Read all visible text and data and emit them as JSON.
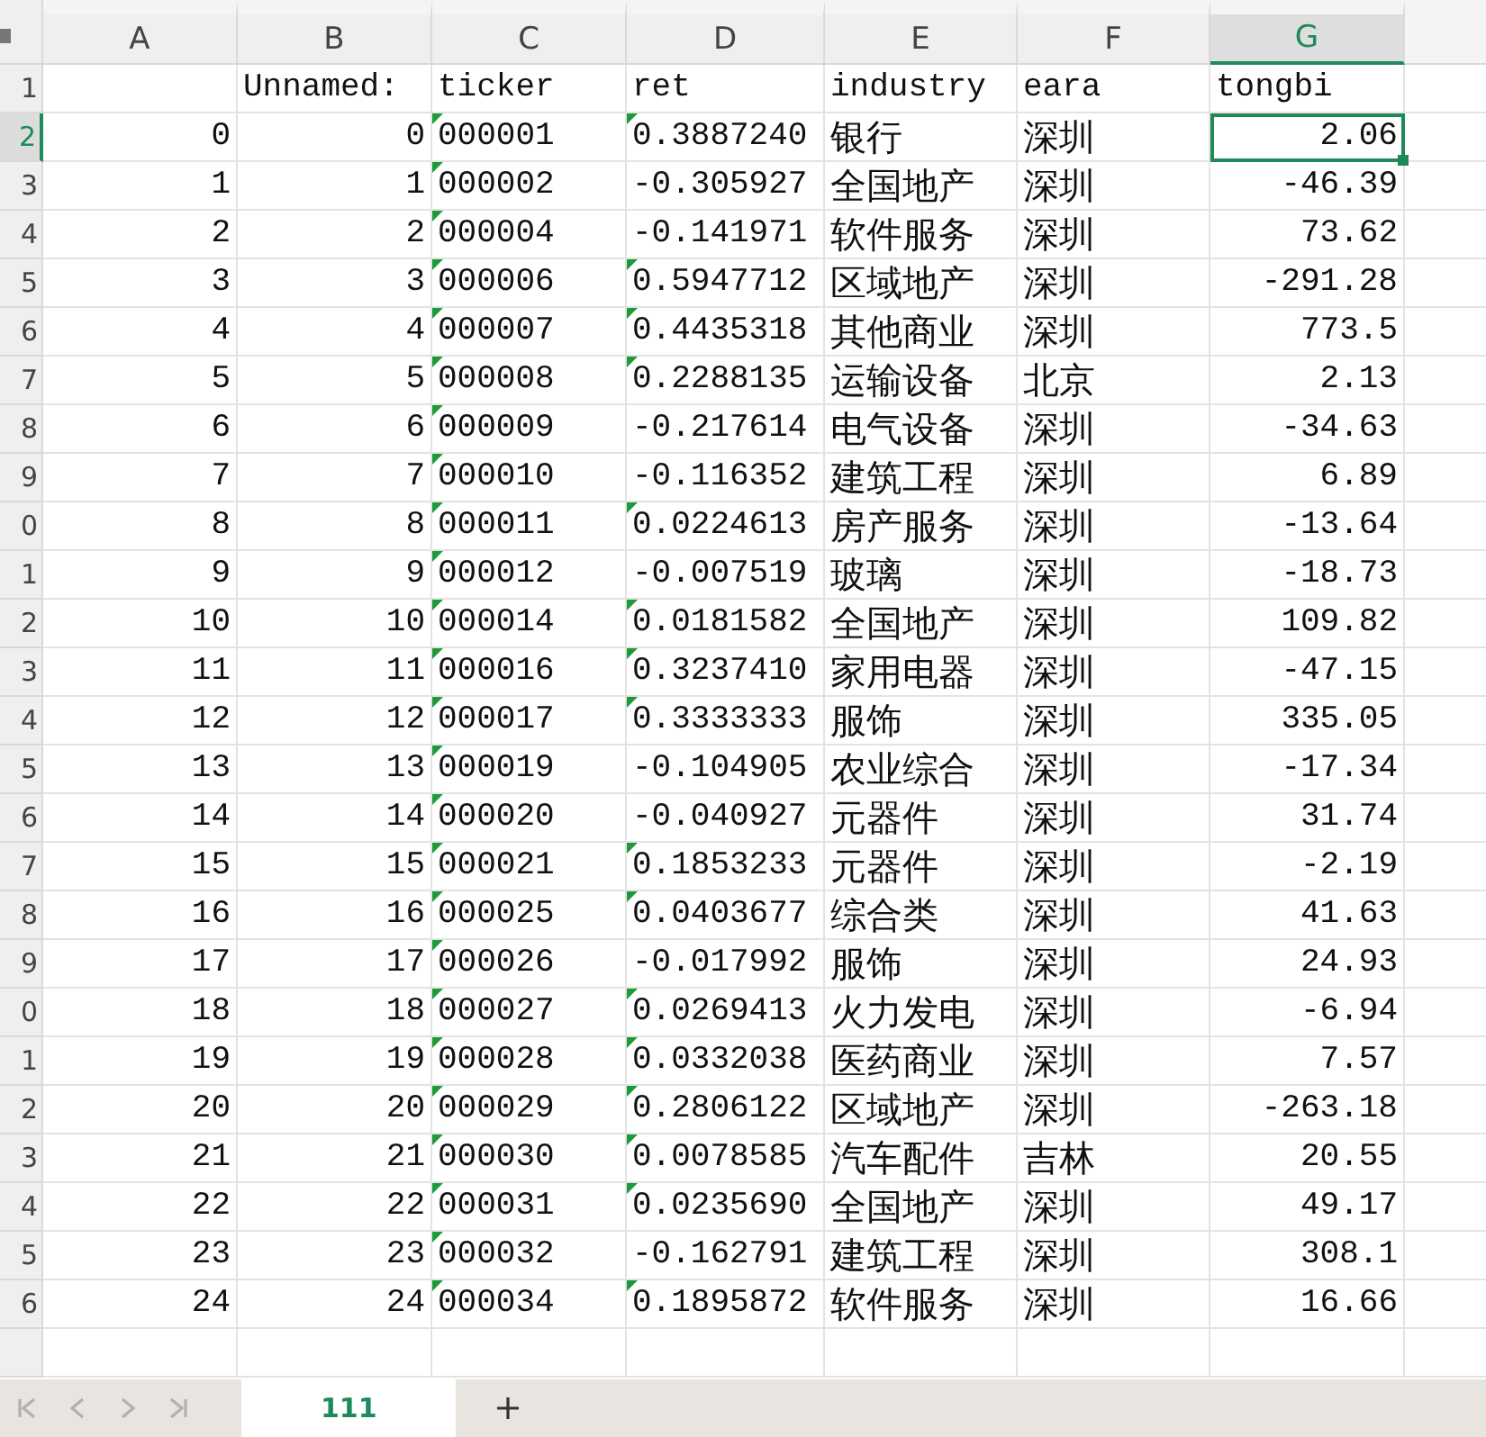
{
  "columns": [
    {
      "label": "A",
      "selected": false
    },
    {
      "label": "B",
      "selected": false
    },
    {
      "label": "C",
      "selected": false
    },
    {
      "label": "D",
      "selected": false
    },
    {
      "label": "E",
      "selected": false
    },
    {
      "label": "F",
      "selected": false
    },
    {
      "label": "G",
      "selected": true
    }
  ],
  "rows": [
    {
      "header": "1",
      "selected": false,
      "cells": [
        {
          "kind": "empty"
        },
        {
          "text": "Unnamed:",
          "kind": "text"
        },
        {
          "text": "ticker",
          "kind": "text"
        },
        {
          "text": "ret",
          "kind": "text"
        },
        {
          "text": "industry",
          "kind": "text"
        },
        {
          "text": "eara",
          "kind": "text"
        },
        {
          "text": "tongbi",
          "kind": "text"
        }
      ]
    },
    {
      "header": "2",
      "selected": true,
      "cells": [
        {
          "text": "0",
          "kind": "number"
        },
        {
          "text": "0",
          "kind": "number"
        },
        {
          "text": "000001",
          "kind": "flagged"
        },
        {
          "text": "0.3887240",
          "kind": "flagged"
        },
        {
          "text": "银行",
          "kind": "text"
        },
        {
          "text": "深圳",
          "kind": "text"
        },
        {
          "text": "2.06",
          "kind": "number"
        }
      ]
    },
    {
      "header": "3",
      "selected": false,
      "cells": [
        {
          "text": "1",
          "kind": "number"
        },
        {
          "text": "1",
          "kind": "number"
        },
        {
          "text": "000002",
          "kind": "flagged"
        },
        {
          "text": "-0.305927",
          "kind": "text"
        },
        {
          "text": "全国地产",
          "kind": "text"
        },
        {
          "text": "深圳",
          "kind": "text"
        },
        {
          "text": "-46.39",
          "kind": "number"
        }
      ]
    },
    {
      "header": "4",
      "selected": false,
      "cells": [
        {
          "text": "2",
          "kind": "number"
        },
        {
          "text": "2",
          "kind": "number"
        },
        {
          "text": "000004",
          "kind": "flagged"
        },
        {
          "text": "-0.141971",
          "kind": "text"
        },
        {
          "text": "软件服务",
          "kind": "text"
        },
        {
          "text": "深圳",
          "kind": "text"
        },
        {
          "text": "73.62",
          "kind": "number"
        }
      ]
    },
    {
      "header": "5",
      "selected": false,
      "cells": [
        {
          "text": "3",
          "kind": "number"
        },
        {
          "text": "3",
          "kind": "number"
        },
        {
          "text": "000006",
          "kind": "flagged"
        },
        {
          "text": "0.5947712",
          "kind": "flagged"
        },
        {
          "text": "区域地产",
          "kind": "text"
        },
        {
          "text": "深圳",
          "kind": "text"
        },
        {
          "text": "-291.28",
          "kind": "number"
        }
      ]
    },
    {
      "header": "6",
      "selected": false,
      "cells": [
        {
          "text": "4",
          "kind": "number"
        },
        {
          "text": "4",
          "kind": "number"
        },
        {
          "text": "000007",
          "kind": "flagged"
        },
        {
          "text": "0.4435318",
          "kind": "flagged"
        },
        {
          "text": "其他商业",
          "kind": "text"
        },
        {
          "text": "深圳",
          "kind": "text"
        },
        {
          "text": "773.5",
          "kind": "number"
        }
      ]
    },
    {
      "header": "7",
      "selected": false,
      "cells": [
        {
          "text": "5",
          "kind": "number"
        },
        {
          "text": "5",
          "kind": "number"
        },
        {
          "text": "000008",
          "kind": "flagged"
        },
        {
          "text": "0.2288135",
          "kind": "flagged"
        },
        {
          "text": "运输设备",
          "kind": "text"
        },
        {
          "text": "北京",
          "kind": "text"
        },
        {
          "text": "2.13",
          "kind": "number"
        }
      ]
    },
    {
      "header": "8",
      "selected": false,
      "cells": [
        {
          "text": "6",
          "kind": "number"
        },
        {
          "text": "6",
          "kind": "number"
        },
        {
          "text": "000009",
          "kind": "flagged"
        },
        {
          "text": "-0.217614",
          "kind": "text"
        },
        {
          "text": "电气设备",
          "kind": "text"
        },
        {
          "text": "深圳",
          "kind": "text"
        },
        {
          "text": "-34.63",
          "kind": "number"
        }
      ]
    },
    {
      "header": "9",
      "selected": false,
      "cells": [
        {
          "text": "7",
          "kind": "number"
        },
        {
          "text": "7",
          "kind": "number"
        },
        {
          "text": "000010",
          "kind": "flagged"
        },
        {
          "text": "-0.116352",
          "kind": "text"
        },
        {
          "text": "建筑工程",
          "kind": "text"
        },
        {
          "text": "深圳",
          "kind": "text"
        },
        {
          "text": "6.89",
          "kind": "number"
        }
      ]
    },
    {
      "header": "0",
      "selected": false,
      "cells": [
        {
          "text": "8",
          "kind": "number"
        },
        {
          "text": "8",
          "kind": "number"
        },
        {
          "text": "000011",
          "kind": "flagged"
        },
        {
          "text": "0.0224613",
          "kind": "flagged"
        },
        {
          "text": "房产服务",
          "kind": "text"
        },
        {
          "text": "深圳",
          "kind": "text"
        },
        {
          "text": "-13.64",
          "kind": "number"
        }
      ]
    },
    {
      "header": "1",
      "selected": false,
      "cells": [
        {
          "text": "9",
          "kind": "number"
        },
        {
          "text": "9",
          "kind": "number"
        },
        {
          "text": "000012",
          "kind": "flagged"
        },
        {
          "text": "-0.007519",
          "kind": "text"
        },
        {
          "text": "玻璃",
          "kind": "text"
        },
        {
          "text": "深圳",
          "kind": "text"
        },
        {
          "text": "-18.73",
          "kind": "number"
        }
      ]
    },
    {
      "header": "2",
      "selected": false,
      "cells": [
        {
          "text": "10",
          "kind": "number"
        },
        {
          "text": "10",
          "kind": "number"
        },
        {
          "text": "000014",
          "kind": "flagged"
        },
        {
          "text": "0.0181582",
          "kind": "flagged"
        },
        {
          "text": "全国地产",
          "kind": "text"
        },
        {
          "text": "深圳",
          "kind": "text"
        },
        {
          "text": "109.82",
          "kind": "number"
        }
      ]
    },
    {
      "header": "3",
      "selected": false,
      "cells": [
        {
          "text": "11",
          "kind": "number"
        },
        {
          "text": "11",
          "kind": "number"
        },
        {
          "text": "000016",
          "kind": "flagged"
        },
        {
          "text": "0.3237410",
          "kind": "flagged"
        },
        {
          "text": "家用电器",
          "kind": "text"
        },
        {
          "text": "深圳",
          "kind": "text"
        },
        {
          "text": "-47.15",
          "kind": "number"
        }
      ]
    },
    {
      "header": "4",
      "selected": false,
      "cells": [
        {
          "text": "12",
          "kind": "number"
        },
        {
          "text": "12",
          "kind": "number"
        },
        {
          "text": "000017",
          "kind": "flagged"
        },
        {
          "text": "0.3333333",
          "kind": "flagged"
        },
        {
          "text": "服饰",
          "kind": "text"
        },
        {
          "text": "深圳",
          "kind": "text"
        },
        {
          "text": "335.05",
          "kind": "number"
        }
      ]
    },
    {
      "header": "5",
      "selected": false,
      "cells": [
        {
          "text": "13",
          "kind": "number"
        },
        {
          "text": "13",
          "kind": "number"
        },
        {
          "text": "000019",
          "kind": "flagged"
        },
        {
          "text": "-0.104905",
          "kind": "text"
        },
        {
          "text": "农业综合",
          "kind": "text"
        },
        {
          "text": "深圳",
          "kind": "text"
        },
        {
          "text": "-17.34",
          "kind": "number"
        }
      ]
    },
    {
      "header": "6",
      "selected": false,
      "cells": [
        {
          "text": "14",
          "kind": "number"
        },
        {
          "text": "14",
          "kind": "number"
        },
        {
          "text": "000020",
          "kind": "flagged"
        },
        {
          "text": "-0.040927",
          "kind": "text"
        },
        {
          "text": "元器件",
          "kind": "text"
        },
        {
          "text": "深圳",
          "kind": "text"
        },
        {
          "text": "31.74",
          "kind": "number"
        }
      ]
    },
    {
      "header": "7",
      "selected": false,
      "cells": [
        {
          "text": "15",
          "kind": "number"
        },
        {
          "text": "15",
          "kind": "number"
        },
        {
          "text": "000021",
          "kind": "flagged"
        },
        {
          "text": "0.1853233",
          "kind": "flagged"
        },
        {
          "text": "元器件",
          "kind": "text"
        },
        {
          "text": "深圳",
          "kind": "text"
        },
        {
          "text": "-2.19",
          "kind": "number"
        }
      ]
    },
    {
      "header": "8",
      "selected": false,
      "cells": [
        {
          "text": "16",
          "kind": "number"
        },
        {
          "text": "16",
          "kind": "number"
        },
        {
          "text": "000025",
          "kind": "flagged"
        },
        {
          "text": "0.0403677",
          "kind": "flagged"
        },
        {
          "text": "综合类",
          "kind": "text"
        },
        {
          "text": "深圳",
          "kind": "text"
        },
        {
          "text": "41.63",
          "kind": "number"
        }
      ]
    },
    {
      "header": "9",
      "selected": false,
      "cells": [
        {
          "text": "17",
          "kind": "number"
        },
        {
          "text": "17",
          "kind": "number"
        },
        {
          "text": "000026",
          "kind": "flagged"
        },
        {
          "text": "-0.017992",
          "kind": "text"
        },
        {
          "text": "服饰",
          "kind": "text"
        },
        {
          "text": "深圳",
          "kind": "text"
        },
        {
          "text": "24.93",
          "kind": "number"
        }
      ]
    },
    {
      "header": "0",
      "selected": false,
      "cells": [
        {
          "text": "18",
          "kind": "number"
        },
        {
          "text": "18",
          "kind": "number"
        },
        {
          "text": "000027",
          "kind": "flagged"
        },
        {
          "text": "0.0269413",
          "kind": "flagged"
        },
        {
          "text": "火力发电",
          "kind": "text"
        },
        {
          "text": "深圳",
          "kind": "text"
        },
        {
          "text": "-6.94",
          "kind": "number"
        }
      ]
    },
    {
      "header": "1",
      "selected": false,
      "cells": [
        {
          "text": "19",
          "kind": "number"
        },
        {
          "text": "19",
          "kind": "number"
        },
        {
          "text": "000028",
          "kind": "flagged"
        },
        {
          "text": "0.0332038",
          "kind": "flagged"
        },
        {
          "text": "医药商业",
          "kind": "text"
        },
        {
          "text": "深圳",
          "kind": "text"
        },
        {
          "text": "7.57",
          "kind": "number"
        }
      ]
    },
    {
      "header": "2",
      "selected": false,
      "cells": [
        {
          "text": "20",
          "kind": "number"
        },
        {
          "text": "20",
          "kind": "number"
        },
        {
          "text": "000029",
          "kind": "flagged"
        },
        {
          "text": "0.2806122",
          "kind": "flagged"
        },
        {
          "text": "区域地产",
          "kind": "text"
        },
        {
          "text": "深圳",
          "kind": "text"
        },
        {
          "text": "-263.18",
          "kind": "number"
        }
      ]
    },
    {
      "header": "3",
      "selected": false,
      "cells": [
        {
          "text": "21",
          "kind": "number"
        },
        {
          "text": "21",
          "kind": "number"
        },
        {
          "text": "000030",
          "kind": "flagged"
        },
        {
          "text": "0.0078585",
          "kind": "flagged"
        },
        {
          "text": "汽车配件",
          "kind": "text"
        },
        {
          "text": "吉林",
          "kind": "text"
        },
        {
          "text": "20.55",
          "kind": "number"
        }
      ]
    },
    {
      "header": "4",
      "selected": false,
      "cells": [
        {
          "text": "22",
          "kind": "number"
        },
        {
          "text": "22",
          "kind": "number"
        },
        {
          "text": "000031",
          "kind": "flagged"
        },
        {
          "text": "0.0235690",
          "kind": "flagged"
        },
        {
          "text": "全国地产",
          "kind": "text"
        },
        {
          "text": "深圳",
          "kind": "text"
        },
        {
          "text": "49.17",
          "kind": "number"
        }
      ]
    },
    {
      "header": "5",
      "selected": false,
      "cells": [
        {
          "text": "23",
          "kind": "number"
        },
        {
          "text": "23",
          "kind": "number"
        },
        {
          "text": "000032",
          "kind": "flagged"
        },
        {
          "text": "-0.162791",
          "kind": "text"
        },
        {
          "text": "建筑工程",
          "kind": "text"
        },
        {
          "text": "深圳",
          "kind": "text"
        },
        {
          "text": "308.1",
          "kind": "number"
        }
      ]
    },
    {
      "header": "6",
      "selected": false,
      "cells": [
        {
          "text": "24",
          "kind": "number"
        },
        {
          "text": "24",
          "kind": "number"
        },
        {
          "text": "000034",
          "kind": "flagged"
        },
        {
          "text": "0.1895872",
          "kind": "flagged"
        },
        {
          "text": "软件服务",
          "kind": "text"
        },
        {
          "text": "深圳",
          "kind": "text"
        },
        {
          "text": "16.66",
          "kind": "number"
        }
      ]
    }
  ],
  "sheet_tabs": [
    {
      "label": "111",
      "selected": true
    }
  ]
}
